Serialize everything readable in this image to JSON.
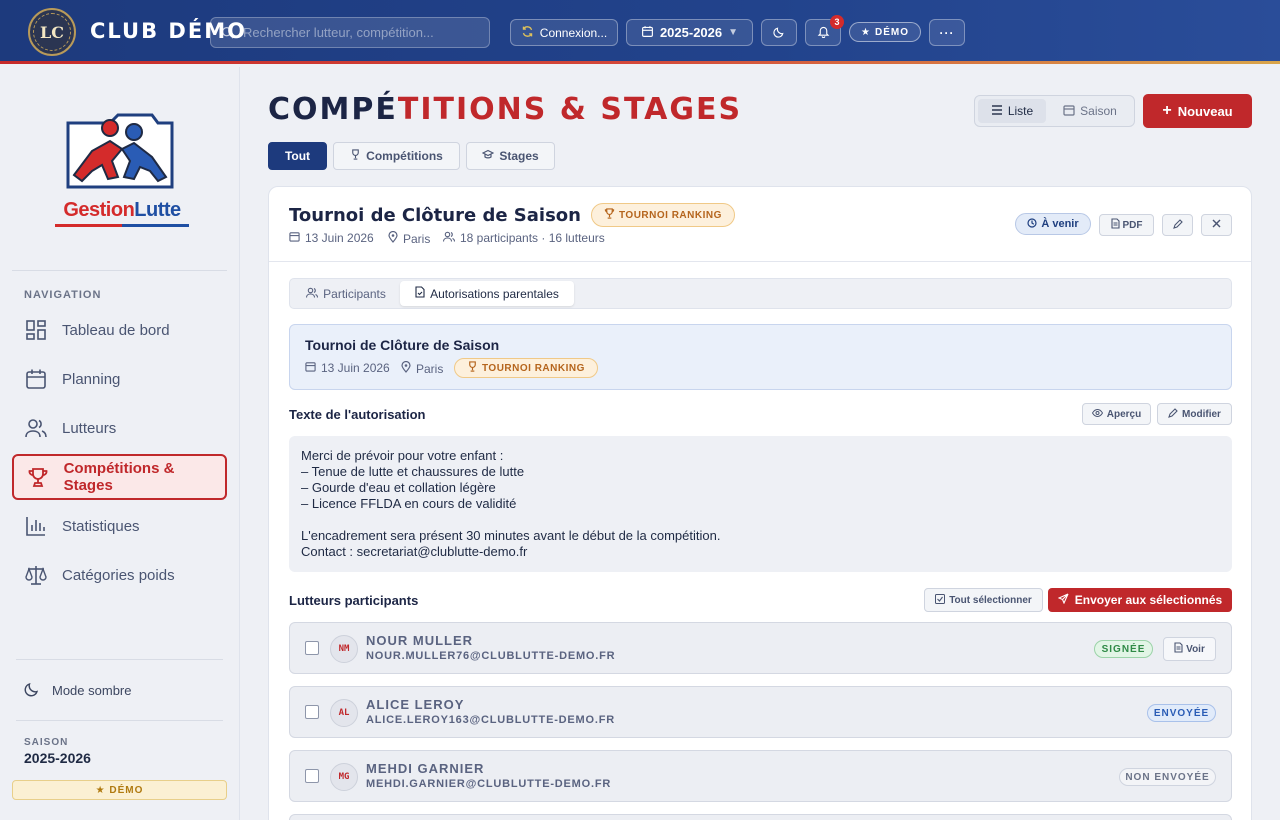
{
  "topbar": {
    "logo_initials": "LC",
    "app_title": "CLUB DÉMO",
    "search_placeholder": "Rechercher lutteur, compétition...",
    "connection_label": "Connexion...",
    "season_label": "2025-2026",
    "notif_count": "3",
    "demo_label": "DÉMO"
  },
  "sidebar": {
    "brand_g": "Gestion",
    "brand_l": "Lutte",
    "nav_title": "NAVIGATION",
    "items": [
      {
        "label": "Tableau de bord",
        "icon": "dashboard-icon"
      },
      {
        "label": "Planning",
        "icon": "calendar-icon"
      },
      {
        "label": "Lutteurs",
        "icon": "users-icon"
      },
      {
        "label": "Compétitions & Stages",
        "icon": "trophy-icon",
        "active": true
      },
      {
        "label": "Statistiques",
        "icon": "bar-chart-icon"
      },
      {
        "label": "Catégories poids",
        "icon": "scale-icon"
      }
    ],
    "dark_mode_label": "Mode sombre",
    "season_title": "SAISON",
    "season_value": "2025-2026",
    "demo_label": "★ DÉMO"
  },
  "main": {
    "title_part1": "COMPÉ",
    "title_part2": "TITIONS & STAGES",
    "view_list": "Liste",
    "view_season": "Saison",
    "new_button": "Nouveau",
    "filters": [
      "Tout",
      "Compétitions",
      "Stages"
    ]
  },
  "competition": {
    "title": "Tournoi de Clôture de Saison",
    "type_badge": "TOURNOI RANKING",
    "date": "13 Juin 2026",
    "location": "Paris",
    "participants": "18 participants · 16 lutteurs",
    "status": "À venir",
    "pdf_label": "PDF",
    "tabs": [
      "Participants",
      "Autorisations parentales"
    ],
    "info_title": "Tournoi de Clôture de Saison",
    "auth_section_title": "Texte de l'autorisation",
    "preview_label": "Aperçu",
    "edit_label": "Modifier",
    "auth_text": "Merci de prévoir pour votre enfant :\n– Tenue de lutte et chaussures de lutte\n– Gourde d'eau et collation légère\n– Licence FFLDA en cours de validité\n\nL'encadrement sera présent 30 minutes avant le début de la compétition.\nContact : secretariat@clublutte-demo.fr",
    "wrestlers_title": "Lutteurs participants",
    "select_all_label": "Tout sélectionner",
    "send_label": "Envoyer aux sélectionnés",
    "wrestlers": [
      {
        "initials": "NM",
        "name": "NOUR MULLER",
        "email": "NOUR.MULLER76@CLUBLUTTE-DEMO.FR",
        "status": "SIGNÉE",
        "view": "Voir"
      },
      {
        "initials": "AL",
        "name": "ALICE LEROY",
        "email": "ALICE.LEROY163@CLUBLUTTE-DEMO.FR",
        "status": "ENVOYÉE"
      },
      {
        "initials": "MG",
        "name": "MEHDI GARNIER",
        "email": "MEHDI.GARNIER@CLUBLUTTE-DEMO.FR",
        "status": "NON ENVOYÉE"
      }
    ]
  }
}
